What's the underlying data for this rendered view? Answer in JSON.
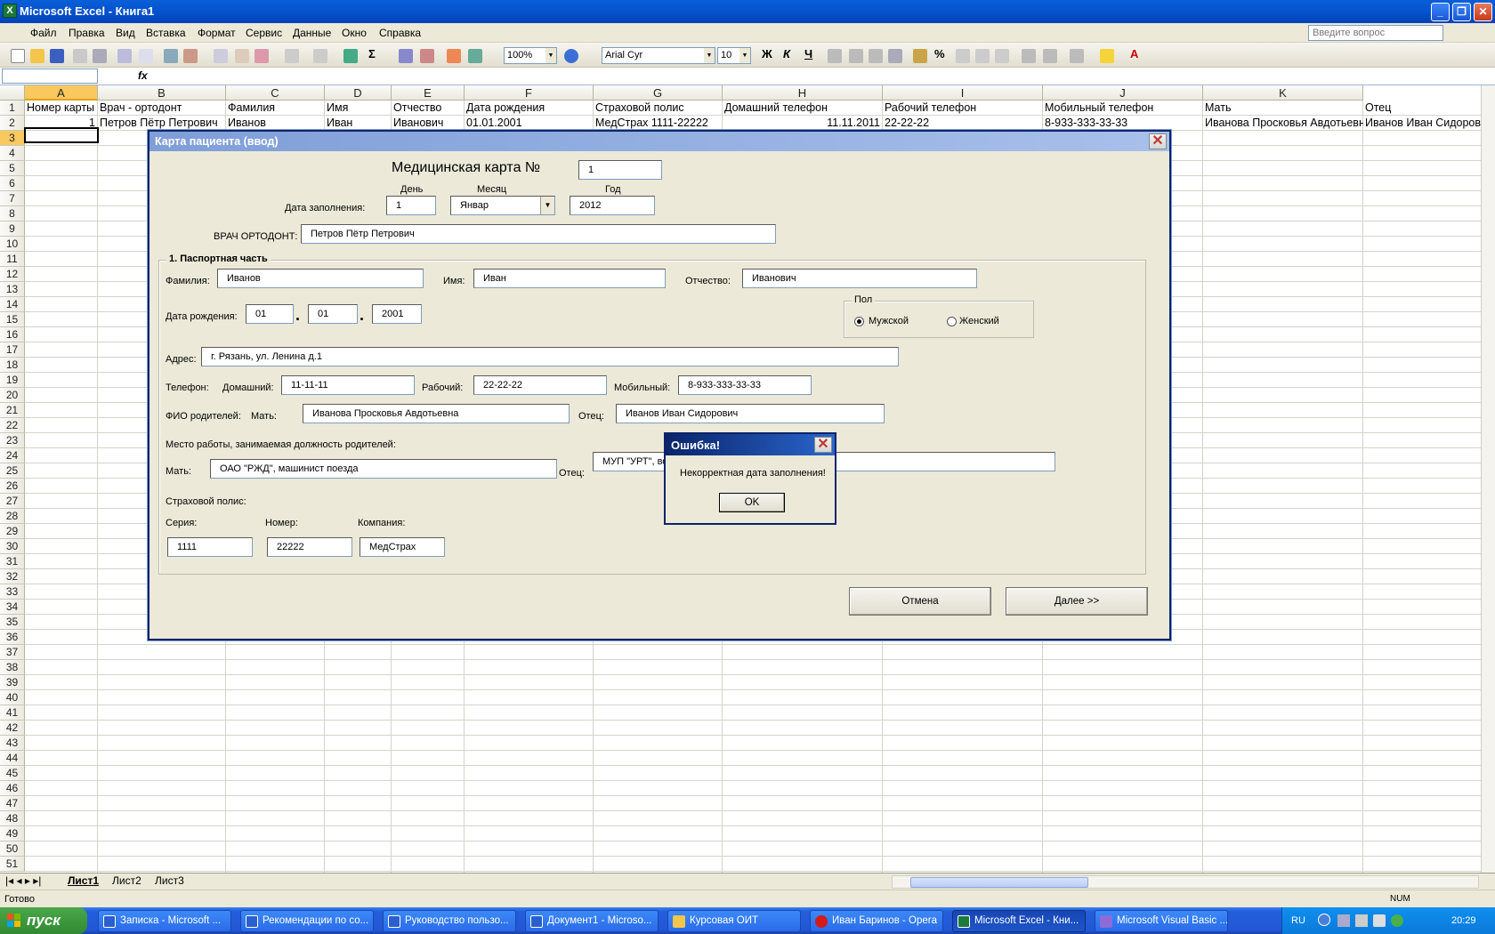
{
  "window": {
    "title": "Microsoft Excel - Книга1"
  },
  "menu": [
    "Файл",
    "Правка",
    "Вид",
    "Вставка",
    "Формат",
    "Сервис",
    "Данные",
    "Окно",
    "Справка"
  ],
  "help_placeholder": "Введите вопрос",
  "toolbar": {
    "zoom": "100%",
    "font": "Arial Cyr",
    "size": "10",
    "bold": "Ж",
    "italic": "К",
    "underline": "Ч"
  },
  "formula_bar": {
    "fx": "fx"
  },
  "columns": [
    "A",
    "B",
    "C",
    "D",
    "E",
    "F",
    "G",
    "H",
    "I",
    "J",
    "K"
  ],
  "rows": [
    "1",
    "2",
    "3",
    "4",
    "5",
    "6",
    "7",
    "8",
    "9",
    "10",
    "11",
    "12",
    "13",
    "14",
    "15",
    "16",
    "17",
    "18",
    "19",
    "20",
    "21",
    "22",
    "23",
    "24",
    "25",
    "26",
    "27",
    "28",
    "29",
    "30",
    "31",
    "32",
    "33",
    "34",
    "35",
    "36",
    "37",
    "38",
    "39",
    "40",
    "41",
    "42",
    "43",
    "44",
    "45",
    "46",
    "47",
    "48",
    "49",
    "50",
    "51"
  ],
  "sheet_row1": [
    "Номер карты",
    "Врач - ортодонт",
    "Фамилия",
    "Имя",
    "Отчество",
    "Дата рождения",
    "Страховой полис",
    "Домашний телефон",
    "Рабочий телефон",
    "Мобильный телефон",
    "Мать",
    "Отец"
  ],
  "sheet_row2": [
    "1",
    "Петров Пётр Петрович",
    "Иванов",
    "Иван",
    "Иванович",
    "01.01.2001",
    "МедСтрах 1111-22222",
    "11.11.2011",
    "22-22-22",
    "8-933-333-33-33",
    "Иванова Просковья Авдотьевна",
    "Иванов Иван Сидорович"
  ],
  "sheets": [
    "Лист1",
    "Лист2",
    "Лист3"
  ],
  "status": {
    "text": "Готово",
    "num": "NUM"
  },
  "form": {
    "title": "Карта пациента (ввод)",
    "card_label": "Медицинская карта №",
    "card_no": "1",
    "day_label": "День",
    "month_label": "Месяц",
    "year_label": "Год",
    "fill_date_label": "Дата заполнения:",
    "fill_day": "1",
    "fill_month": "Январ",
    "fill_year": "2012",
    "doctor_label": "ВРАЧ ОРТОДОНТ:",
    "doctor": "Петров Пётр Петрович",
    "section1": "1. Паспортная часть",
    "surname_label": "Фамилия:",
    "surname": "Иванов",
    "name_label": "Имя:",
    "name": "Иван",
    "patronymic_label": "Отчество:",
    "patronymic": "Иванович",
    "birth_label": "Дата рождения:",
    "birth_day": "01",
    "birth_month": "01",
    "birth_year": "2001",
    "dot": ".",
    "gender_label": "Пол",
    "male": "Мужской",
    "female": "Женский",
    "gender_selected": "Мужской",
    "address_label": "Адрес:",
    "address": "г. Рязань, ул. Ленина д.1",
    "phone_label": "Телефон:",
    "home_label": "Домашний:",
    "home": "11-11-11",
    "work_label": "Рабочий:",
    "work": "22-22-22",
    "mobile_label": "Мобильный:",
    "mobile": "8-933-333-33-33",
    "parents_label": "ФИО родителей:",
    "mother_label": "Мать:",
    "mother": "Иванова Просковья Авдотьевна",
    "father_label": "Отец:",
    "father": "Иванов Иван Сидорович",
    "job_label": "Место работы, занимаемая должность родителей:",
    "mother_job": "ОАО \"РЖД\", машинист поезда",
    "father_job": "МУП \"УРТ\", во",
    "insurance_label": "Страховой полис:",
    "series_label": "Серия:",
    "series": "1111",
    "number_label": "Номер:",
    "number": "22222",
    "company_label": "Компания:",
    "company": "МедСтрах",
    "cancel": "Отмена",
    "next": "Далее >>"
  },
  "msgbox": {
    "title": "Ошибка!",
    "text": "Некорректная дата заполнения!",
    "ok": "OK"
  },
  "taskbar": {
    "start": "пуск",
    "tasks": [
      "Записка - Microsoft ...",
      "Рекомендации по со...",
      "Руководство пользо...",
      "Документ1 - Microso...",
      "Курсовая ОИТ",
      "Иван Баринов - Opera",
      "Microsoft Excel - Кни...",
      "Microsoft Visual Basic ..."
    ],
    "lang": "RU",
    "time": "20:29"
  }
}
